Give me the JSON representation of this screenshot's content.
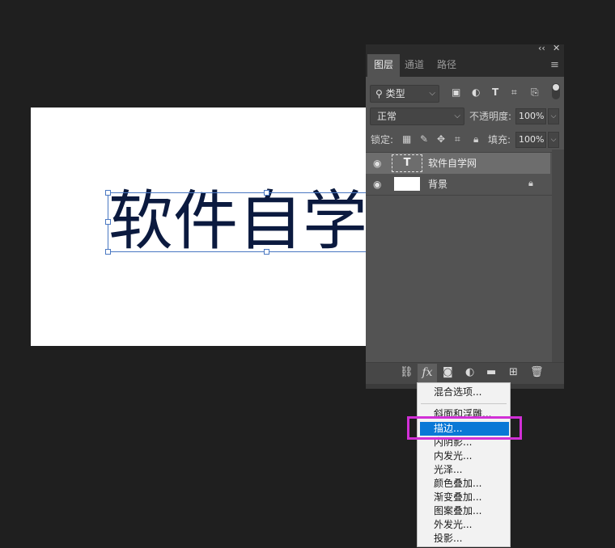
{
  "canvas": {
    "text": "软件自学网"
  },
  "panel": {
    "tabs": [
      {
        "label": "图层",
        "active": true
      },
      {
        "label": "通道",
        "active": false
      },
      {
        "label": "路径",
        "active": false
      }
    ],
    "filter": {
      "label": "类型"
    },
    "blend_mode": "正常",
    "opacity_label": "不透明度:",
    "opacity_value": "100%",
    "lock_label": "锁定:",
    "fill_label": "填充:",
    "fill_value": "100%",
    "layers": [
      {
        "name": "软件自学网",
        "type": "text",
        "thumb_glyph": "T",
        "selected": true
      },
      {
        "name": "背景",
        "type": "background",
        "locked": true
      }
    ],
    "footer_fx": "fx"
  },
  "context_menu": {
    "items": [
      {
        "label": "混合选项..."
      },
      {
        "label": "斜面和浮雕..."
      },
      {
        "label": "描边...",
        "highlighted": true
      },
      {
        "label": "内阴影..."
      },
      {
        "label": "内发光..."
      },
      {
        "label": "光泽..."
      },
      {
        "label": "颜色叠加..."
      },
      {
        "label": "渐变叠加..."
      },
      {
        "label": "图案叠加..."
      },
      {
        "label": "外发光..."
      },
      {
        "label": "投影..."
      }
    ]
  },
  "colors": {
    "highlight": "#0a78d6",
    "annotation": "#d12fd6",
    "selection_border": "#4a78c2"
  }
}
